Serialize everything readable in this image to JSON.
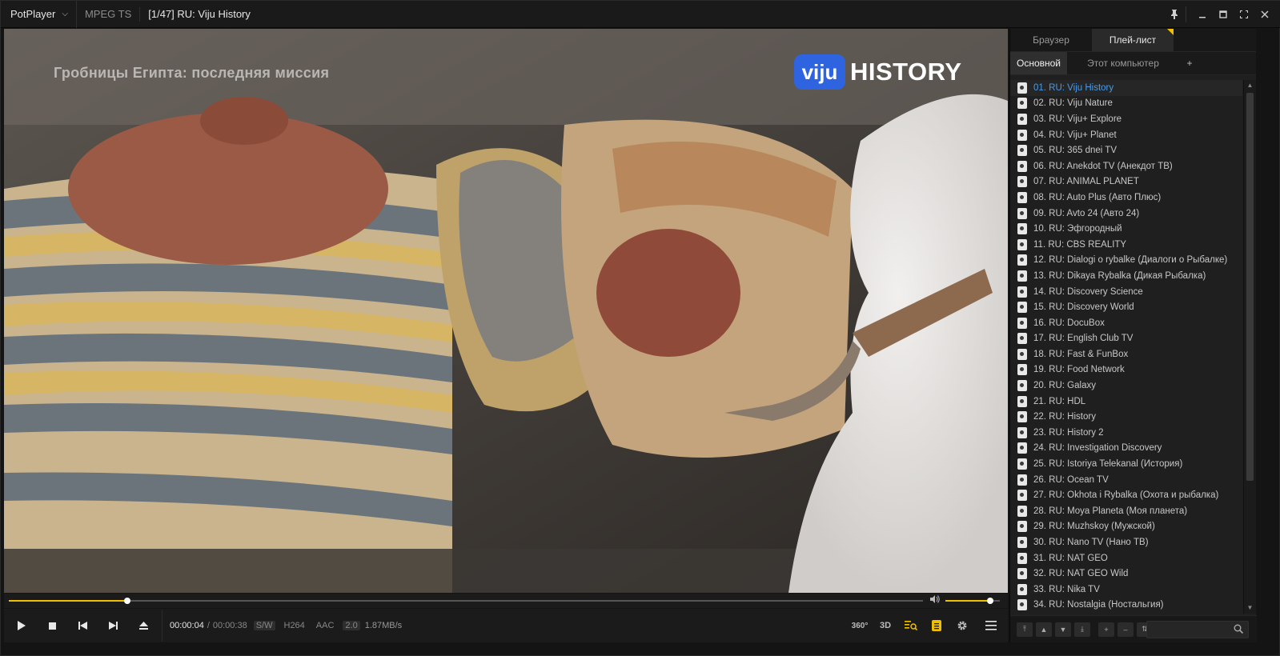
{
  "titlebar": {
    "app_name": "PotPlayer",
    "format": "MPEG TS",
    "title": "[1/47] RU: Viju History"
  },
  "video": {
    "overlay_title": "Гробницы Египта: последняя миссия",
    "brand_box": "viju",
    "brand_word": "HISTORY"
  },
  "playback": {
    "position_fraction": 0.13,
    "volume_fraction": 0.82
  },
  "controls": {
    "time_current": "00:00:04",
    "time_separator": "/",
    "time_total": "00:00:38",
    "tag_sw": "S/W",
    "tag_codec": "H264",
    "tag_audio": "AAC",
    "tag_channels": "2.0",
    "speed": "1.87MB/s",
    "btn_360": "360°",
    "btn_3d": "3D"
  },
  "panel": {
    "tabs": [
      "Браузер",
      "Плей-лист"
    ],
    "subtabs": [
      "Основной",
      "Этот компьютер",
      "+"
    ],
    "playlist": [
      "01. RU: Viju History",
      "02. RU: Viju Nature",
      "03. RU: Viju+ Explore",
      "04. RU: Viju+ Planet",
      "05. RU: 365 dnei TV",
      "06. RU: Anekdot TV (Анекдот ТВ)",
      "07. RU: ANIMAL PLANET",
      "08. RU: Auto Plus (Авто Плюс)",
      "09. RU: Avto 24 (Авто 24)",
      "10. RU:  Эфгородный",
      "11. RU: CBS REALITY",
      "12. RU: Dialogi o rybalke (Диалоги о Рыбалке)",
      "13. RU: Dikaya Rybalka (Дикая Рыбалка)",
      "14. RU: Discovery Science",
      "15. RU: Discovery World",
      "16. RU: DocuBox",
      "17. RU: English Club TV",
      "18. RU: Fast & FunBox",
      "19. RU: Food Network",
      "20. RU: Galaxy",
      "21. RU: HDL",
      "22. RU: History",
      "23. RU: History 2",
      "24. RU: Investigation Discovery",
      "25. RU: Istoriya Telekanal (История)",
      "26. RU: Ocean TV",
      "27. RU: Okhota i Rybalka (Охота и рыбалка)",
      "28. RU: Moya Planeta (Моя планета)",
      "29. RU: Muzhskoy (Мужской)",
      "30. RU: Nano TV (Нано ТВ)",
      "31. RU: NAT GEO",
      "32. RU: NAT GEO Wild",
      "33. RU: Nika TV",
      "34. RU: Nostalgia (Ностальгия)"
    ],
    "search_placeholder": ""
  }
}
